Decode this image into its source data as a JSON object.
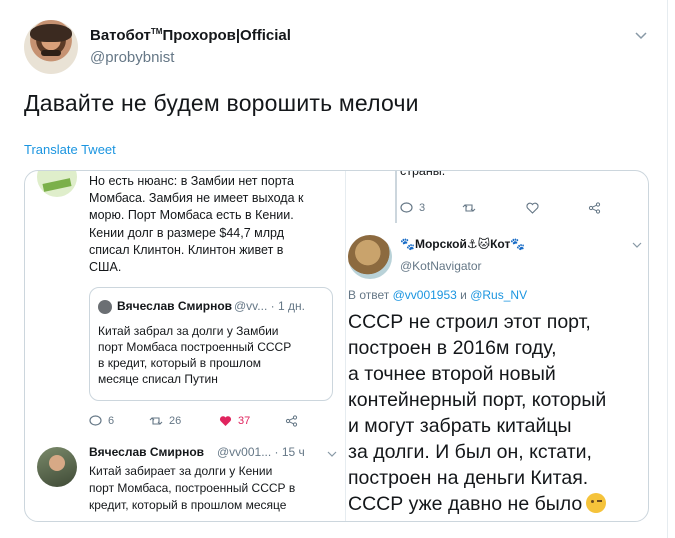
{
  "tweet": {
    "author_name": "Ватобот",
    "author_tm": "TM",
    "author_name_rest": "Прохоров|Official",
    "handle": "@probybnist",
    "text": "Давайте не будем ворошить мелочи",
    "translate_label": "Translate Tweet",
    "menu_icon": "chevron-down-icon"
  },
  "embedded_screenshot": {
    "left_pane": {
      "reply_text": "Но есть нюанс: в Замбии нет порта\nМомбаса. Замбия не имеет выхода к\nморю. Порт Момбаса есть в Кении.\nКении долг в размере $44,7 млрд\nсписал Клинтон. Клинтон живет в\nСША.",
      "quote": {
        "name": "Вячеслав Смирнов",
        "meta": "@vv... · 1 дн.",
        "text": "Китай забрал за долги у Замбии\nпорт Момбаса построенный СССР\nв кредит, который в прошлом\nмесяце списал Путин"
      },
      "actions": {
        "replies": "6",
        "retweets": "26",
        "likes": "37"
      },
      "next_tweet": {
        "name": "Вячеслав Смирнов",
        "meta": "@vv001... · 15 ч",
        "text": "Китай забирает за долги у Кении\nпорт Момбаса, построенный СССР в\nкредит, который в прошлом месяце"
      }
    },
    "right_pane": {
      "top_text": "страны.",
      "actions": {
        "replies": "3"
      },
      "name": "🐾Морской⚓🐱Кот🐾",
      "handle": "@KotNavigator",
      "reply_prefix": "В ответ ",
      "reply_mention_1": "@vv001953",
      "reply_and": " и ",
      "reply_mention_2": "@Rus_NV",
      "text": "СССР не строил этот порт,\nпостроен в 2016м году,\nа точнее второй новый\nконтейнерный порт, который\nи могут забрать китайцы\nза долги. И был он, кстати,\nпостроен на деньги Китая.\nСССР уже давно не было"
    }
  },
  "colors": {
    "link": "#1b95e0",
    "muted": "#657786",
    "text": "#14171a",
    "like": "#e0245e",
    "border": "#ccd6dd"
  }
}
